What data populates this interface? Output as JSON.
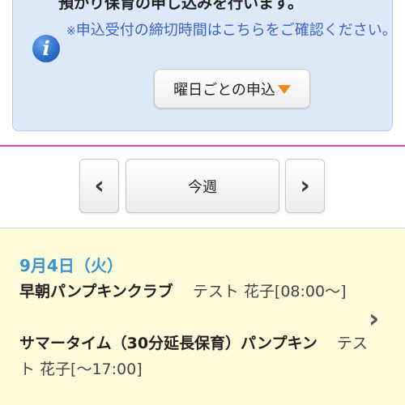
{
  "info_panel": {
    "title": "預かり保育の申し込みを行います。",
    "note_mark": "※",
    "note": "申込受付の締切時間はこちらをご確認ください。",
    "icon": "info-icon",
    "weekday_button_label": "曜日ごとの申込",
    "dropdown_icon": "triangle-down-icon"
  },
  "week_nav": {
    "prev_icon": "chevron-left-icon",
    "prev_glyph": "‹",
    "current_label": "今週",
    "next_icon": "chevron-right-icon",
    "next_glyph": "›"
  },
  "schedule": {
    "date": "9月4日（火）",
    "entries": [
      {
        "program": "早朝パンプキンクラブ",
        "child": "テスト 花子",
        "time": "[08:00〜]"
      },
      {
        "program": "サマータイム（30分延長保育）パンプキン",
        "child": "テスト 花子",
        "time": "[〜17:00]"
      }
    ],
    "row_icon": "chevron-right-icon",
    "row_glyph": "›"
  },
  "colors": {
    "panel_bg": "#dde8f8",
    "note_text": "#3a63c7",
    "accent_pink": "#e64b9c",
    "date_blue": "#3b93cf",
    "schedule_bg": "#fdfbd9",
    "dropdown_orange": "#f08a1a"
  }
}
